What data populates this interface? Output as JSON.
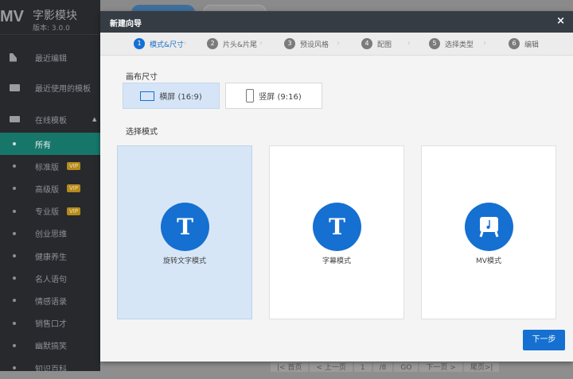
{
  "app": {
    "logo": "MV",
    "name": "字影模块",
    "version": "版本: 3.0.0"
  },
  "sidebar": {
    "top_items": [
      {
        "label": "最近编辑"
      },
      {
        "label": "最近使用的模板"
      },
      {
        "label": "在线模板"
      }
    ],
    "categories": [
      {
        "label": "所有",
        "active": true
      },
      {
        "label": "标准版",
        "badge": "VIP"
      },
      {
        "label": "高级版",
        "badge": "VIP"
      },
      {
        "label": "专业版",
        "badge": "VIP"
      },
      {
        "label": "创业思维"
      },
      {
        "label": "健康养生"
      },
      {
        "label": "名人语句"
      },
      {
        "label": "情感语录"
      },
      {
        "label": "销售口才"
      },
      {
        "label": "幽默搞笑"
      },
      {
        "label": "知识百科"
      }
    ]
  },
  "pager": [
    "|< 首页",
    "< 上一页",
    "1",
    "/8",
    "GO",
    "下一页 >",
    "尾页>|"
  ],
  "modal": {
    "title": "新建向导",
    "close": "×",
    "steps": [
      {
        "n": "1",
        "label": "模式&尺寸"
      },
      {
        "n": "2",
        "label": "片头&片尾"
      },
      {
        "n": "3",
        "label": "预设风格"
      },
      {
        "n": "4",
        "label": "配图"
      },
      {
        "n": "5",
        "label": "选择类型"
      },
      {
        "n": "6",
        "label": "编辑"
      }
    ],
    "canvas_label": "画布尺寸",
    "canvas_options": [
      {
        "label": "横屏 (16:9)"
      },
      {
        "label": "竖屏 (9:16)"
      }
    ],
    "mode_label": "选择模式",
    "modes": [
      {
        "glyph": "T",
        "label": "旋转文字模式"
      },
      {
        "glyph": "T",
        "label": "字幕模式"
      },
      {
        "label": "MV模式"
      }
    ],
    "next": "下一步"
  },
  "colors": {
    "accent": "#1570d1",
    "sidebar_active": "#17766a",
    "header": "#353c44"
  }
}
